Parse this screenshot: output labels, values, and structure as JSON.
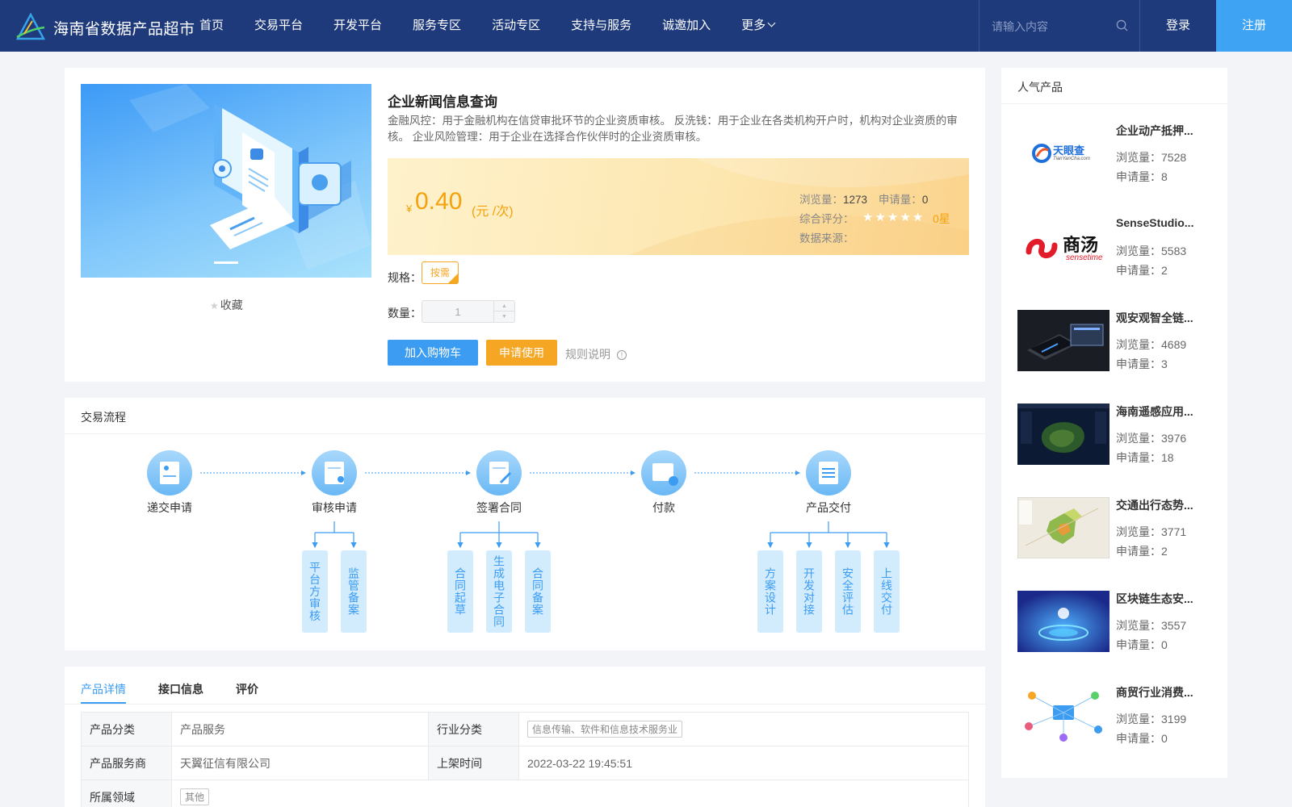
{
  "header": {
    "site_name": "海南省数据产品超市",
    "nav": [
      "首页",
      "交易平台",
      "开发平台",
      "服务专区",
      "活动专区",
      "支持与服务",
      "诚邀加入",
      "更多"
    ],
    "search_placeholder": "请输入内容",
    "login": "登录",
    "register": "注册"
  },
  "product": {
    "title": "企业新闻信息查询",
    "description": "金融风控：用于金融机构在信贷审批环节的企业资质审核。 反洗钱：用于企业在各类机构开户时，机构对企业资质的审核。 企业风险管理：用于企业在选择合作伙伴时的企业资质审核。",
    "favorite": "收藏",
    "currency": "¥",
    "price": "0.40",
    "price_unit": "(元 /次)",
    "views_label": "浏览量：",
    "views": "1273",
    "applies_label": "申请量：",
    "applies": "0",
    "rating_label": "综合评分：",
    "rating_stars": 0,
    "rating_text": "0星",
    "source_label": "数据来源：",
    "spec_label": "规格：",
    "spec_value": "按需",
    "qty_label": "数量：",
    "qty_value": "1",
    "add_cart": "加入购物车",
    "apply": "申请使用",
    "rules": "规则说明"
  },
  "flow": {
    "title": "交易流程",
    "steps": [
      "递交申请",
      "审核申请",
      "签署合同",
      "付款",
      "产品交付"
    ],
    "sub_steps": {
      "审核申请": [
        "平台方审核",
        "监管备案"
      ],
      "签署合同": [
        "合同起草",
        "生成电子合同",
        "合同备案"
      ],
      "产品交付": [
        "方案设计",
        "开发对接",
        "安全评估",
        "上线交付"
      ]
    }
  },
  "details": {
    "tabs": [
      "产品详情",
      "接口信息",
      "评价"
    ],
    "rows": [
      [
        {
          "label": "产品分类",
          "value": "产品服务"
        },
        {
          "label": "行业分类",
          "value": "信息传输、软件和信息技术服务业"
        }
      ],
      [
        {
          "label": "产品服务商",
          "value": "天翼征信有限公司"
        },
        {
          "label": "上架时间",
          "value": "2022-03-22 19:45:51"
        }
      ],
      [
        {
          "label": "所属领域",
          "value": "其他"
        }
      ]
    ]
  },
  "sidebar": {
    "title": "人气产品",
    "views_label": "浏览量：",
    "applies_label": "申请量：",
    "items": [
      {
        "name": "企业动产抵押...",
        "views": "7528",
        "applies": "8",
        "thumb": "tianyancha",
        "logo_text": "天眼查",
        "logo_sub": "TianYanCha.com"
      },
      {
        "name": "SenseStudio...",
        "views": "5583",
        "applies": "2",
        "thumb": "sensetime",
        "logo_text": "商汤",
        "logo_sub": "sensetime"
      },
      {
        "name": "观安观智全链...",
        "views": "4689",
        "applies": "3",
        "thumb": "device"
      },
      {
        "name": "海南遥感应用...",
        "views": "3976",
        "applies": "18",
        "thumb": "satellite"
      },
      {
        "name": "交通出行态势...",
        "views": "3771",
        "applies": "2",
        "thumb": "map"
      },
      {
        "name": "区块链生态安...",
        "views": "3557",
        "applies": "0",
        "thumb": "blockchain"
      },
      {
        "name": "商贸行业消费...",
        "views": "3199",
        "applies": "0",
        "thumb": "network"
      }
    ]
  },
  "colors": {
    "header_bg": "#1e3a7b",
    "primary": "#3b9cf2",
    "accent": "#f5a623",
    "register_bg": "#3da3f2"
  }
}
